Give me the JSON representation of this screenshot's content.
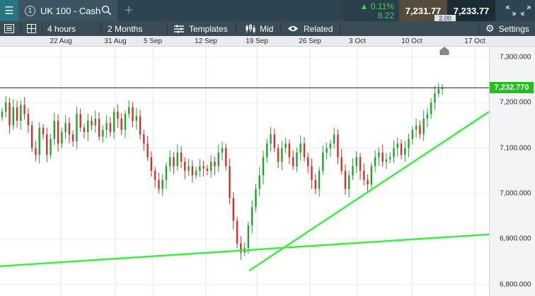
{
  "header": {
    "instrument": "UK 100 - Cash",
    "change_pct": "0.11%",
    "change_pts": "8.22",
    "sell_price": "7,231.77",
    "buy_price": "7,233.77",
    "spread": "2.00"
  },
  "toolbar": {
    "timeframe": "4 hours",
    "range": "2 Months",
    "templates_label": "Templates",
    "price_type": "Mid",
    "related_label": "Related",
    "settings_label": "Settings"
  },
  "colors": {
    "bullish": "#1fa42b",
    "bearish": "#d62d2d",
    "trendline": "#35f03a",
    "last_price": "#20c01f"
  },
  "chart_data": {
    "type": "candlestick",
    "x_ticks": [
      "22 Aug",
      "31 Aug",
      "5 Sep",
      "12 Sep",
      "19 Sep",
      "26 Sep",
      "3 Oct",
      "10 Oct",
      "17 Oct"
    ],
    "y_ticks": [
      "7,300.000",
      "7,200.000",
      "7,100.000",
      "7,000.000",
      "6,900.000",
      "6,800.000"
    ],
    "ylim": [
      6800,
      7300
    ],
    "last_price": "7,232.770",
    "closes": [
      7180,
      7200,
      7150,
      7190,
      7160,
      7195,
      7175,
      7150,
      7100,
      7085,
      7145,
      7130,
      7085,
      7120,
      7160,
      7110,
      7135,
      7155,
      7130,
      7115,
      7175,
      7145,
      7135,
      7160,
      7150,
      7165,
      7125,
      7140,
      7155,
      7135,
      7180,
      7165,
      7140,
      7175,
      7190,
      7160,
      7170,
      7130,
      7110,
      7080,
      7050,
      7030,
      7010,
      7030,
      7060,
      7080,
      7060,
      7090,
      7070,
      7050,
      7060,
      7040,
      7050,
      7060,
      7055,
      7050,
      7070,
      7060,
      7090,
      7100,
      7060,
      6990,
      6940,
      6890,
      6870,
      6880,
      6930,
      6970,
      7010,
      7040,
      7080,
      7110,
      7130,
      7100,
      7070,
      7100,
      7110,
      7080,
      7060,
      7090,
      7110,
      7080,
      7060,
      7030,
      7010,
      7050,
      7090,
      7100,
      7110,
      7130,
      7080,
      7050,
      7010,
      7040,
      7060,
      7080,
      7050,
      7030,
      7020,
      7060,
      7080,
      7090,
      7070,
      7075,
      7080,
      7100,
      7110,
      7085,
      7100,
      7120,
      7140,
      7150,
      7130,
      7165,
      7175,
      7200,
      7220,
      7230,
      7232
    ],
    "trendlines": [
      {
        "y_start": 6840,
        "y_end": 6910
      },
      {
        "y_start": 6830,
        "y_end": 7180
      }
    ]
  }
}
